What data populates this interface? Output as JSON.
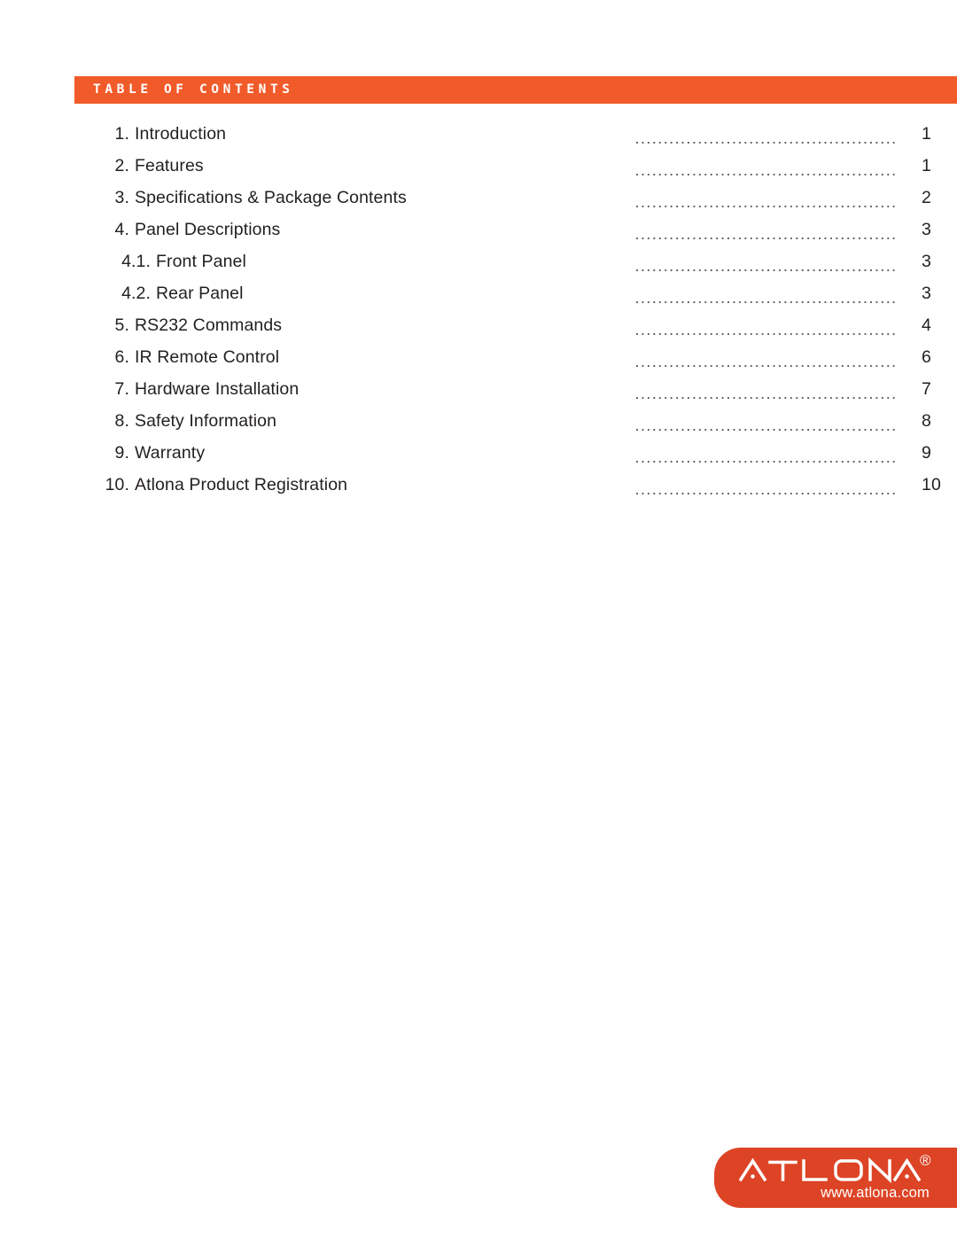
{
  "page": {
    "background_color": "#ffffff"
  },
  "header": {
    "title": "Table of Contents",
    "band_color": "#f15a29",
    "text_color": "#ffffff"
  },
  "toc": {
    "leader_style": "dotted",
    "rows": [
      {
        "number": "1.",
        "label": "Introduction",
        "page": "1",
        "level": 1
      },
      {
        "number": "2.",
        "label": "Features",
        "page": "1",
        "level": 1
      },
      {
        "number": "3.",
        "label": "Specifications & Package Contents",
        "page": "2",
        "level": 1
      },
      {
        "number": "4.",
        "label": "Panel Descriptions",
        "page": "3",
        "level": 1
      },
      {
        "number": "4.1.",
        "label": "Front Panel",
        "page": "3",
        "level": 2
      },
      {
        "number": "4.2.",
        "label": "Rear Panel",
        "page": "3",
        "level": 2
      },
      {
        "number": "5.",
        "label": "RS232 Commands",
        "page": "4",
        "level": 1
      },
      {
        "number": "6.",
        "label": "IR Remote Control",
        "page": "6",
        "level": 1
      },
      {
        "number": "7.",
        "label": "Hardware Installation",
        "page": "7",
        "level": 1
      },
      {
        "number": "8.",
        "label": "Safety Information",
        "page": "8",
        "level": 1
      },
      {
        "number": "9.",
        "label": "Warranty",
        "page": "9",
        "level": 1
      },
      {
        "number": "10.",
        "label": "Atlona Product Registration",
        "page": "10",
        "level": 1
      }
    ]
  },
  "logo": {
    "brand": "ATLONA",
    "registered_mark": "®",
    "url": "www.atlona.com",
    "background_color": "#dd4425",
    "text_color": "#ffffff"
  }
}
